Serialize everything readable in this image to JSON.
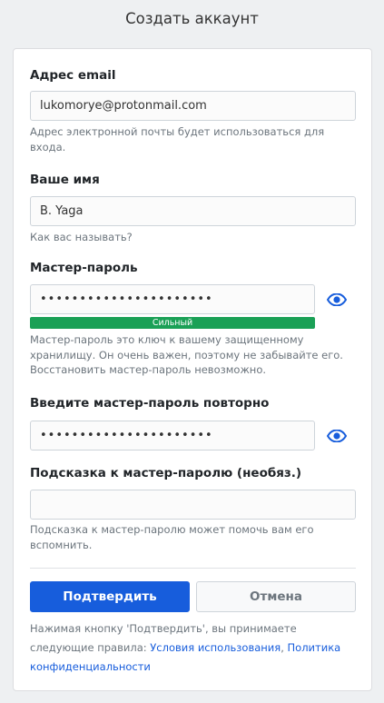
{
  "window": {
    "title": "Создать аккаунт"
  },
  "form": {
    "email": {
      "label": "Адрес email",
      "value": "lukomorye@protonmail.com",
      "help": "Адрес электронной почты будет использоваться для входа."
    },
    "name": {
      "label": "Ваше имя",
      "value": "B. Yaga",
      "help": "Как вас называть?"
    },
    "master_password": {
      "label": "Мастер-пароль",
      "value": "••••••••••••••••••••••",
      "strength_label": "Сильный",
      "strength_level": 1.0,
      "strength_color": "#1aa056",
      "help": "Мастер-пароль это ключ к вашему защищенному хранилищу. Он очень важен, поэтому не забывайте его. Восстановить мастер-пароль невозможно."
    },
    "master_password_confirm": {
      "label": "Введите мастер-пароль повторно",
      "value": "••••••••••••••••••••••"
    },
    "hint": {
      "label": "Подсказка к мастер-паролю (необяз.)",
      "value": "",
      "help": "Подсказка к мастер-паролю может помочь вам его вспомнить."
    }
  },
  "actions": {
    "submit_label": "Подтвердить",
    "cancel_label": "Отмена"
  },
  "terms": {
    "prefix": "Нажимая кнопку 'Подтвердить', вы принимаете следующие правила: ",
    "terms_link": "Условия использования",
    "separator": ", ",
    "privacy_link": "Политика конфиденциальности"
  },
  "icons": {
    "toggle_visibility": "eye-icon"
  },
  "colors": {
    "accent": "#175ddc",
    "success": "#1aa056"
  }
}
